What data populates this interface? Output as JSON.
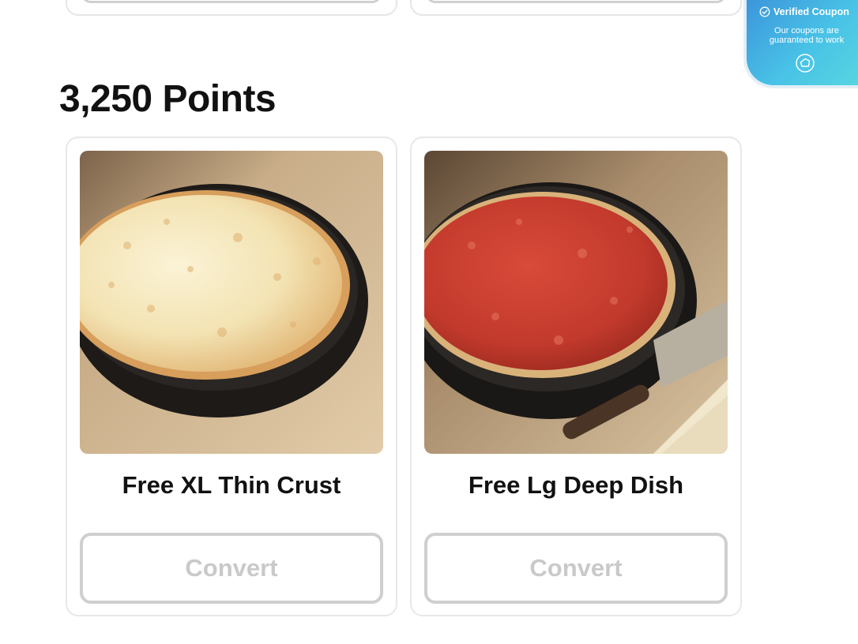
{
  "section": {
    "title": "3,250 Points"
  },
  "rewards": [
    {
      "name": "Free XL Thin Crust",
      "button_label": "Convert",
      "image": "cheese-thin-crust-pizza-in-pan"
    },
    {
      "name": "Free Lg Deep Dish",
      "button_label": "Convert",
      "image": "deep-dish-pizza-in-pan-with-server"
    }
  ],
  "badge": {
    "title": "Verified Coupon",
    "subtitle": "Our coupons are guaranteed to work",
    "icons": [
      "check-circle-icon",
      "brand-logo-icon"
    ]
  },
  "colors": {
    "button_border": "#cfcfcf",
    "button_text": "#c9c9c9",
    "badge_gradient_start": "#3a8fd9",
    "badge_gradient_end": "#5ad8e0"
  }
}
